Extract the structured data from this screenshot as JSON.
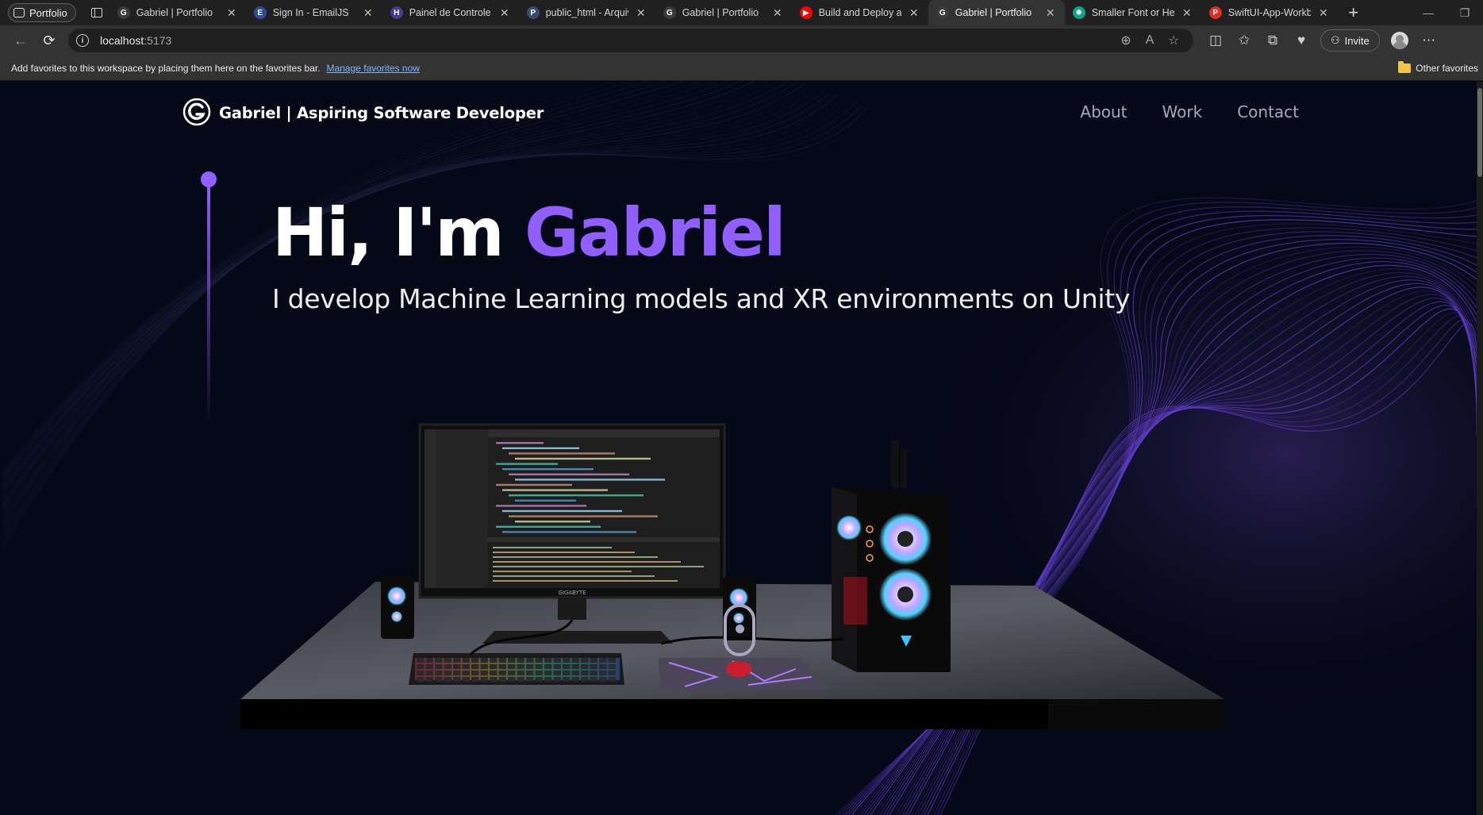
{
  "browser": {
    "workspace_label": "Portfolio",
    "tabs": [
      {
        "title": "Gabriel | Portfolio",
        "icon": "github-icon",
        "color": "#3a3a3a",
        "glyph": "G"
      },
      {
        "title": "Sign In - EmailJS",
        "icon": "emailjs-icon",
        "color": "#2d4a9b",
        "glyph": "E"
      },
      {
        "title": "Painel de Controle |",
        "icon": "panel-icon",
        "color": "#4b3a8c",
        "glyph": "H"
      },
      {
        "title": "public_html - Arquiv",
        "icon": "file-manager-icon",
        "color": "#3b4a6b",
        "glyph": "P"
      },
      {
        "title": "Gabriel | Portfolio",
        "icon": "github-icon",
        "color": "#3a3a3a",
        "glyph": "G"
      },
      {
        "title": "Build and Deploy an",
        "icon": "youtube-icon",
        "color": "#ff0000",
        "glyph": "▶"
      },
      {
        "title": "Gabriel | Portfolio",
        "icon": "github-icon",
        "color": "#3a3a3a",
        "glyph": "G"
      },
      {
        "title": "Smaller Font or Hea",
        "icon": "chatgpt-icon",
        "color": "#10a37f",
        "glyph": "✺"
      },
      {
        "title": "SwiftUI-App-Workbo",
        "icon": "pdf-icon",
        "color": "#d93025",
        "glyph": "P"
      }
    ],
    "active_tab_index": 6,
    "url_host": "localhost",
    "url_port": ":5173",
    "invite_label": "Invite",
    "favorites_message": "Add favorites to this workspace by placing them here on the favorites bar.",
    "manage_favorites_label": "Manage favorites now",
    "other_favorites_label": "Other favorites"
  },
  "site": {
    "brand": "Gabriel  | Aspiring Software Developer",
    "nav": [
      "About",
      "Work",
      "Contact"
    ],
    "hero": {
      "greeting": "Hi, I'm ",
      "name": "Gabriel",
      "subtitle": "I develop Machine Learning models and XR environments on Unity"
    },
    "accent_color": "#915eff",
    "monitor_brand": "GIGABYTE"
  }
}
